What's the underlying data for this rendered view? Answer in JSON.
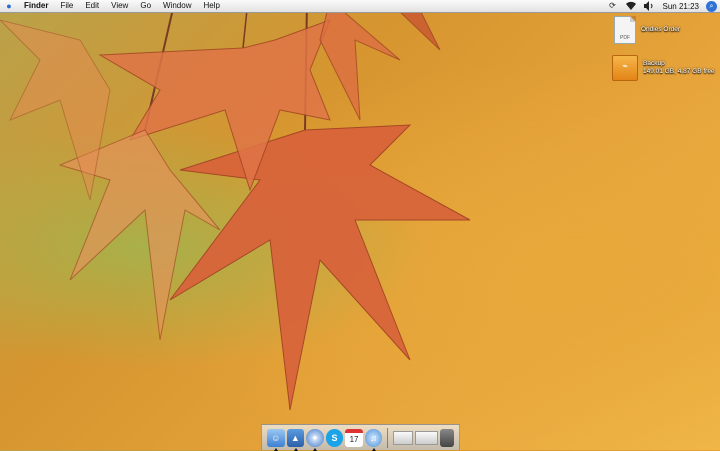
{
  "menubar": {
    "apple_icon": "apple-icon",
    "app_name": "Finder",
    "menus": [
      "File",
      "Edit",
      "View",
      "Go",
      "Window",
      "Help"
    ],
    "status_icons": [
      "sync-icon",
      "wifi-icon",
      "volume-icon"
    ],
    "clock": "Sun 21:23",
    "spotlight_icon": "spotlight-icon"
  },
  "desktop_icons": [
    {
      "label": "Ondies Order",
      "kind": "pdf-file-icon",
      "badge": "PDF"
    },
    {
      "label": "Backup",
      "sublabel": "149.01 GB, 4.87 GB free",
      "kind": "external-drive-icon"
    }
  ],
  "dock": {
    "apps": [
      {
        "name": "finder-icon",
        "running": true
      },
      {
        "name": "preview-icon",
        "running": true
      },
      {
        "name": "safari-icon",
        "running": true
      },
      {
        "name": "skype-icon",
        "running": false
      },
      {
        "name": "ical-icon",
        "date": "17",
        "running": false
      },
      {
        "name": "itunes-icon",
        "running": true
      }
    ],
    "tray": [
      "downloads-stack-icon",
      "documents-stack-icon",
      "trash-icon"
    ]
  },
  "colors": {
    "accent": "#2f73d6",
    "leaf": "#d9623a"
  }
}
